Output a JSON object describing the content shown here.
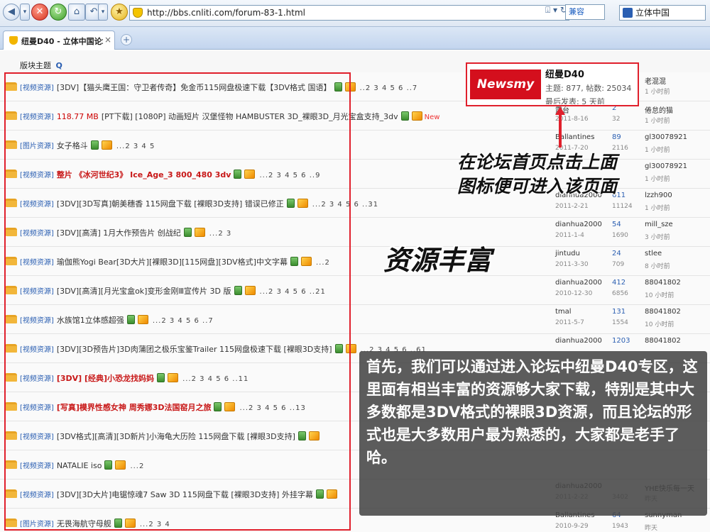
{
  "browser": {
    "url": "http://bbs.cnliti.com/forum-83-1.html",
    "compat_label": "兼容",
    "search_text": "立体中国",
    "tab_title": "纽曼D40 - 立体中国论坛...",
    "tab_close": "×",
    "tab_new": "+",
    "nav": {
      "back": "◀",
      "forward": "▾",
      "stop": "✕",
      "refresh": "↻",
      "home": "⌂",
      "history": "↶",
      "menu": "▾",
      "fav": "★"
    },
    "url_icons": "⍗ ▾ ↻"
  },
  "forum": {
    "quick_label": "版块主题",
    "quick_icon": "Q",
    "rows": [
      {
        "cat": "[视频资源]",
        "size": "",
        "title": "[3DV]【猫头鹰王国：守卫者传奇】免金币115网盘极速下载【3DV格式 国语】",
        "red": false,
        "pages": "..2 3 4 5 6 ..7",
        "new": "",
        "author": "",
        "adate": "",
        "replies": "",
        "views": "",
        "lastby": "老混混",
        "lasttime": "1 小时前"
      },
      {
        "cat": "[视频资源]",
        "size": "118.77 MB",
        "title": "[PT下载] [1080P] 动画短片 汉堡怪物 HAMBUSTER 3D_裸眼3D_月光宝盒支持_3dv",
        "red": false,
        "pages": "",
        "new": "New",
        "author": "露台",
        "adate": "2011-8-16",
        "replies": "2",
        "views": "32",
        "lastby": "倦怠的猫",
        "lasttime": "1 小时前"
      },
      {
        "cat": "[图片资源]",
        "size": "",
        "title": "女子格斗",
        "red": false,
        "pages": "...2 3 4 5",
        "new": "",
        "author": "Ballantines",
        "adate": "2011-7-20",
        "replies": "89",
        "views": "2116",
        "lastby": "gl30078921",
        "lasttime": "1 小时前"
      },
      {
        "cat": "[视频资源]",
        "size": "",
        "title": "整片 《冰河世纪3》 Ice_Age_3 800_480 3dv",
        "red": true,
        "pages": "...2 3 4 5 6 ..9",
        "new": "",
        "author": "",
        "adate": "",
        "replies": "",
        "views": "",
        "lastby": "gl30078921",
        "lasttime": "1 小时前"
      },
      {
        "cat": "[视频资源]",
        "size": "",
        "title": "[3DV][3D写真]朝美穗香 115网盘下载 [裸眼3D支持] 错误已修正",
        "red": false,
        "pages": "...2 3 4 5 6 ..31",
        "new": "",
        "author": "dianhua2000",
        "adate": "2011-2-21",
        "replies": "611",
        "views": "11124",
        "lastby": "lzzh900",
        "lasttime": "1 小时前"
      },
      {
        "cat": "[视频资源]",
        "size": "",
        "title": "[3DV][高清] 1月大作预告片 创战纪",
        "red": false,
        "pages": "...2 3",
        "new": "",
        "author": "dianhua2000",
        "adate": "2011-1-4",
        "replies": "54",
        "views": "1690",
        "lastby": "mill_sze",
        "lasttime": "3 小时前"
      },
      {
        "cat": "[视频资源]",
        "size": "",
        "title": "瑜伽熊Yogi Bear[3D大片][裸眼3D][115网盘][3DV格式]中文字幕",
        "red": false,
        "pages": "...2",
        "new": "",
        "author": "jintudu",
        "adate": "2011-3-30",
        "replies": "24",
        "views": "709",
        "lastby": "stlee",
        "lasttime": "8 小时前"
      },
      {
        "cat": "[视频资源]",
        "size": "",
        "title": "[3DV][高清][月光宝盒ok]变形金刚Ⅲ宣传片 3D 版",
        "red": false,
        "pages": "...2 3 4 5 6 ..21",
        "new": "",
        "author": "dianhua2000",
        "adate": "2010-12-30",
        "replies": "412",
        "views": "6856",
        "lastby": "88041802",
        "lasttime": "10 小时前"
      },
      {
        "cat": "[视频资源]",
        "size": "",
        "title": "水族馆1立体感超强",
        "red": false,
        "pages": "...2 3 4 5 6 ..7",
        "new": "",
        "author": "tmal",
        "adate": "2011-5-7",
        "replies": "131",
        "views": "1554",
        "lastby": "88041802",
        "lasttime": "10 小时前"
      },
      {
        "cat": "[视频资源]",
        "size": "",
        "title": "[3DV][3D预告片]3D肉蒲团之极乐宝鉴Trailer 115网盘极速下载 [裸眼3D支持]",
        "red": false,
        "pages": "...2 3 4 5 6 ..61",
        "new": "",
        "author": "dianhua2000",
        "adate": "",
        "replies": "1203",
        "views": "",
        "lastby": "88041802",
        "lasttime": ""
      },
      {
        "cat": "[视频资源]",
        "size": "",
        "title": "[3DV] [经典]小恐龙找妈妈",
        "red": true,
        "pages": "...2 3 4 5 6 ..11",
        "new": "",
        "author": "",
        "adate": "",
        "replies": "",
        "views": "",
        "lastby": "",
        "lasttime": ""
      },
      {
        "cat": "[视频资源]",
        "size": "",
        "title": "[写真]模界性感女神 周秀娜3D法国窑月之旅",
        "red": true,
        "pages": "...2 3 4 5 6 ..13",
        "new": "",
        "author": "",
        "adate": "",
        "replies": "",
        "views": "",
        "lastby": "",
        "lasttime": ""
      },
      {
        "cat": "[视频资源]",
        "size": "",
        "title": "[3DV格式][高清][3D新片]小海龟大历险 115网盘下载 [裸眼3D支持]",
        "red": false,
        "pages": "",
        "new": "",
        "author": "",
        "adate": "",
        "replies": "",
        "views": "",
        "lastby": "",
        "lasttime": ""
      },
      {
        "cat": "[视频资源]",
        "size": "",
        "title": "NATALIE iso",
        "red": false,
        "pages": "...2",
        "new": "",
        "author": "",
        "adate": "",
        "replies": "",
        "views": "",
        "lastby": "",
        "lasttime": ""
      },
      {
        "cat": "[视频资源]",
        "size": "",
        "title": "[3DV][3D大片]电锯惊魂7 Saw 3D 115网盘下载 [裸眼3D支持] 外挂字幕",
        "red": false,
        "pages": "",
        "new": "",
        "author": "dianhua2000",
        "adate": "2011-2-22",
        "replies": "",
        "views": "3402",
        "lastby": "YHE快乐每一天",
        "lasttime": "昨天"
      },
      {
        "cat": "[图片资源]",
        "size": "",
        "title": "无畏海航守母舰",
        "red": false,
        "pages": "...2 3 4",
        "new": "",
        "author": "Ballantines",
        "adate": "2010-9-29",
        "replies": "64",
        "views": "1943",
        "lastby": "sunnyman",
        "lasttime": "昨天"
      }
    ]
  },
  "logo_card": {
    "brand": "Newsmy",
    "name": "纽曼D40",
    "stats": "主题: 877, 帖数: 25034",
    "last": "最后发表: 5 天前"
  },
  "annotations": {
    "callout_line1": "在论坛首页点击上面",
    "callout_line2": "图标便可进入该页面",
    "rich": "资源丰富",
    "description": "首先，我们可以通过进入论坛中纽曼D40专区，这里面有相当丰富的资源够大家下载，特别是其中大多数都是3DV格式的裸眼3D资源，而且论坛的形式也是大多数用户最为熟悉的，大家都是老手了哈。"
  },
  "colors": {
    "frame": "#e0202c",
    "accent": "#2b5fb2",
    "brand": "#d40f1d"
  }
}
